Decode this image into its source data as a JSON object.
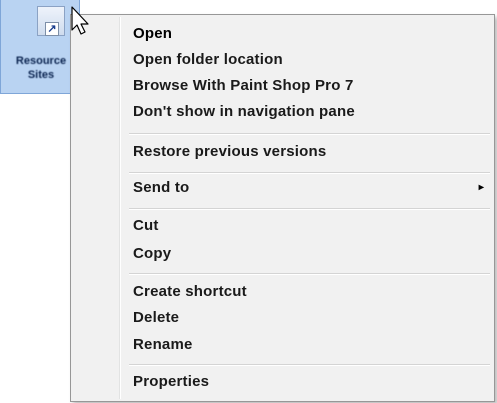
{
  "desktop": {
    "shortcut": {
      "label": "Resource\nSites",
      "icon": "shortcut-icon",
      "selected": true,
      "selection_color": "#b9d3f2"
    }
  },
  "context_menu": {
    "items": [
      {
        "label": "Open",
        "default": true
      },
      {
        "label": "Open folder location"
      },
      {
        "label": "Browse With Paint Shop Pro 7"
      },
      {
        "label": "Don't show in navigation pane"
      },
      {
        "label": "Restore previous versions"
      },
      {
        "label": "Send to",
        "submenu": "▸"
      },
      {
        "label": "Cut"
      },
      {
        "label": "Copy"
      },
      {
        "label": "Create shortcut"
      },
      {
        "label": "Delete"
      },
      {
        "label": "Rename"
      },
      {
        "label": "Properties"
      }
    ],
    "background": "#f1f1f1",
    "border": "#979797"
  }
}
